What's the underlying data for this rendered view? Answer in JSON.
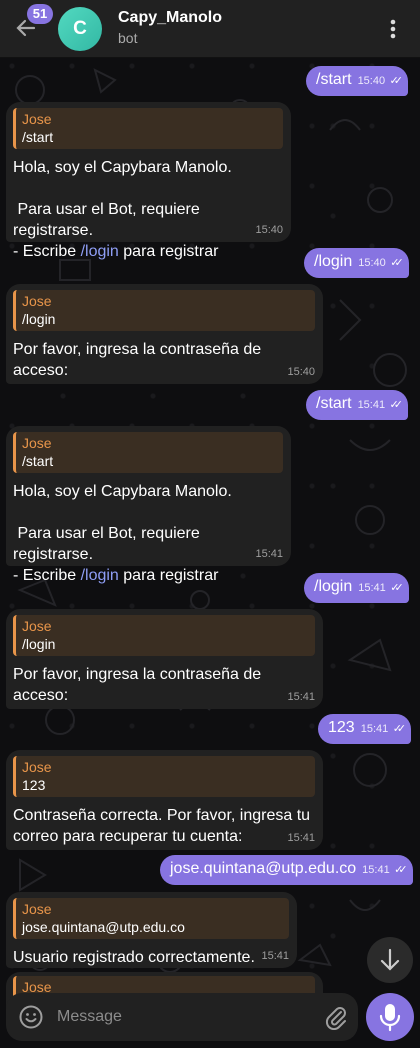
{
  "header": {
    "unread_count": "51",
    "avatar_letter": "C",
    "title": "Capy_Manolo",
    "subtitle": "bot"
  },
  "messages": [
    {
      "id": "m1",
      "type": "out",
      "text": "/start",
      "time": "15:40"
    },
    {
      "id": "m2",
      "type": "in",
      "reply_name": "Jose",
      "reply_text": "/start",
      "line1": "Hola, soy el Capybara Manolo.",
      "line2": " Para usar el Bot, requiere registrarse.",
      "line3_pre": "- Escribe ",
      "line3_link": "/login",
      "line3_post": " para registrar",
      "time": "15:40"
    },
    {
      "id": "m3",
      "type": "out",
      "text": "/login",
      "time": "15:40"
    },
    {
      "id": "m4",
      "type": "in",
      "reply_name": "Jose",
      "reply_text": "/login",
      "line1": "Por favor, ingresa la contraseña de",
      "line2": "acceso:",
      "time": "15:40"
    },
    {
      "id": "m5",
      "type": "out",
      "text": "/start",
      "time": "15:41"
    },
    {
      "id": "m6",
      "type": "in",
      "reply_name": "Jose",
      "reply_text": "/start",
      "line1": "Hola, soy el Capybara Manolo.",
      "line2": " Para usar el Bot, requiere registrarse.",
      "line3_pre": "- Escribe ",
      "line3_link": "/login",
      "line3_post": " para registrar",
      "time": "15:41"
    },
    {
      "id": "m7",
      "type": "out",
      "text": "/login",
      "time": "15:41"
    },
    {
      "id": "m8",
      "type": "in",
      "reply_name": "Jose",
      "reply_text": "/login",
      "line1": "Por favor, ingresa la contraseña de",
      "line2": "acceso:",
      "time": "15:41"
    },
    {
      "id": "m9",
      "type": "out",
      "text": "123",
      "time": "15:41"
    },
    {
      "id": "m10",
      "type": "in",
      "reply_name": "Jose",
      "reply_text": "123",
      "line1": "Contraseña correcta. Por favor, ingresa tu",
      "line2": "correo para recuperar tu cuenta:",
      "time": "15:41"
    },
    {
      "id": "m11",
      "type": "out",
      "text": "jose.quintana@utp.edu.co",
      "time": "15:41"
    },
    {
      "id": "m12",
      "type": "in",
      "reply_name": "Jose",
      "reply_text": "jose.quintana@utp.edu.co",
      "line1": "Usuario registrado correctamente.",
      "time": "15:41"
    },
    {
      "id": "m13",
      "type": "in",
      "reply_name": "Jose"
    }
  ],
  "composer": {
    "placeholder": "Message"
  },
  "icons": {
    "back": "arrow-left-icon",
    "more": "more-vertical-icon",
    "scroll": "arrow-down-icon",
    "emoji": "smiley-icon",
    "attach": "paperclip-icon",
    "mic": "microphone-icon",
    "read": "double-check-icon"
  },
  "colors": {
    "accent": "#8774e1",
    "incoming_bubble": "#212121",
    "reply_name": "#e8954a",
    "link": "#8f9ef5",
    "background": "#0e0e10"
  }
}
